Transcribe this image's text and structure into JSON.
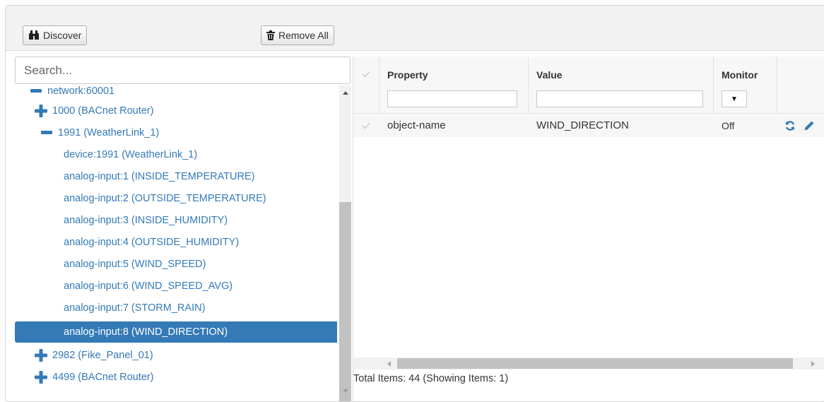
{
  "toolbar": {
    "discover_label": "Discover",
    "remove_all_label": "Remove All"
  },
  "search": {
    "placeholder": "Search..."
  },
  "tree": {
    "network": "network:60001",
    "items": [
      {
        "label": "1000 (BACnet Router)",
        "toggle": "plus"
      },
      {
        "label": "1991 (WeatherLink_1)",
        "toggle": "minus"
      },
      {
        "label": "device:1991 (WeatherLink_1)"
      },
      {
        "label": "analog-input:1 (INSIDE_TEMPERATURE)"
      },
      {
        "label": "analog-input:2 (OUTSIDE_TEMPERATURE)"
      },
      {
        "label": "analog-input:3 (INSIDE_HUMIDITY)"
      },
      {
        "label": "analog-input:4 (OUTSIDE_HUMIDITY)"
      },
      {
        "label": "analog-input:5 (WIND_SPEED)"
      },
      {
        "label": "analog-input:6 (WIND_SPEED_AVG)"
      },
      {
        "label": "analog-input:7 (STORM_RAIN)"
      },
      {
        "label": "analog-input:8 (WIND_DIRECTION)",
        "selected": true
      },
      {
        "label": "2982 (Fike_Panel_01)",
        "toggle": "plus"
      },
      {
        "label": "4499 (BACnet Router)",
        "toggle": "plus"
      }
    ]
  },
  "grid": {
    "headers": {
      "property": "Property",
      "value": "Value",
      "monitor": "Monitor"
    },
    "monitor_filter": "",
    "rows": [
      {
        "property": "object-name",
        "value": "WIND_DIRECTION",
        "monitor": "Off"
      }
    ],
    "footer": "Total Items: 44 (Showing Items: 1)"
  },
  "colors": {
    "accent": "#337ab7",
    "toolbar_bg": "#f2f2f2"
  }
}
